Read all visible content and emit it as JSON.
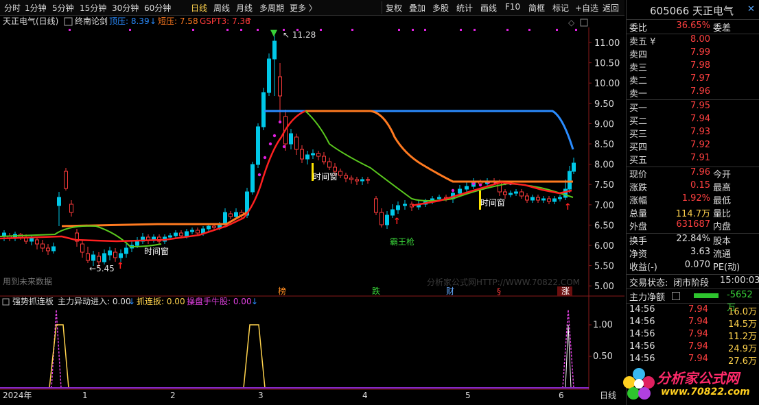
{
  "toolbar": {
    "periods": [
      "分时",
      "1分钟",
      "5分钟",
      "15分钟",
      "30分钟",
      "60分钟",
      "日线",
      "周线",
      "月线",
      "多周期",
      "更多 〉"
    ],
    "active_period": "日线",
    "actions": [
      "复权",
      "叠加",
      "多股",
      "统计",
      "画线",
      "F10",
      "简框",
      "标记",
      "+自选",
      "返回"
    ]
  },
  "main": {
    "stock_name": "天正电气(日线)",
    "indicator_name": "终南论剑",
    "top_pressure": "顶压: 8.39",
    "short_pressure": "短压: 7.58",
    "gspt": "GSPT3: 7.36",
    "high_label": "11.28",
    "low_label": "5.45",
    "watermark_left": "用到未来数据",
    "watermark_right": "分析家公式网HTTP://WWW.70822.COM",
    "annotations": [
      "时间窗",
      "时间窗",
      "时间窗",
      "霸王枪"
    ],
    "event_marks": [
      "榜",
      "跌",
      "财",
      "§",
      "涨"
    ],
    "y_ticks": [
      "11.00",
      "10.50",
      "10.00",
      "9.50",
      "9.00",
      "8.50",
      "8.00",
      "7.50",
      "7.00",
      "6.50",
      "6.00",
      "5.50",
      "5.00"
    ],
    "colors": {
      "up": "#ff3b3b",
      "down": "#00c8e8",
      "red_line": "#ff2020",
      "orange": "#ff7a20",
      "green": "#5ac81e",
      "blue": "#2a8cff",
      "magenta": "#e020e0"
    }
  },
  "sub": {
    "indicator_name": "强势抓连板",
    "field1": "主力异动进入: 0.00",
    "field2": "抓连扳: 0.00",
    "field3": "操盘手牛股: 0.00",
    "y_ticks": [
      "1.00",
      "0.50"
    ]
  },
  "x_axis": {
    "labels": [
      "2024年",
      "1",
      "2",
      "3",
      "4",
      "5",
      "6"
    ],
    "right_label": "日线"
  },
  "panel": {
    "code": "605066",
    "name": "天正电气",
    "weibi": {
      "label": "委比",
      "value": "36.65%",
      "right": "委差"
    },
    "sells": [
      {
        "label": "卖五 ¥",
        "price": "8.00"
      },
      {
        "label": "卖四",
        "price": "7.99"
      },
      {
        "label": "卖三",
        "price": "7.98"
      },
      {
        "label": "卖二",
        "price": "7.97"
      },
      {
        "label": "卖一",
        "price": "7.96"
      }
    ],
    "buys": [
      {
        "label": "买一",
        "price": "7.95"
      },
      {
        "label": "买二",
        "price": "7.94"
      },
      {
        "label": "买三",
        "price": "7.93"
      },
      {
        "label": "买四",
        "price": "7.92"
      },
      {
        "label": "买五",
        "price": "7.91"
      }
    ],
    "stats": [
      {
        "label": "现价",
        "value": "7.96",
        "right": "今开",
        "color": "red"
      },
      {
        "label": "涨跌",
        "value": "0.15",
        "right": "最高",
        "color": "red"
      },
      {
        "label": "涨幅",
        "value": "1.92%",
        "right": "最低",
        "color": "red"
      },
      {
        "label": "总量",
        "value": "114.7万",
        "right": "量比",
        "color": "yel"
      },
      {
        "label": "外盘",
        "value": "631687",
        "right": "内盘",
        "color": "red"
      }
    ],
    "stats2": [
      {
        "label": "换手",
        "value": "22.84%",
        "right": "股本"
      },
      {
        "label": "净资",
        "value": "3.63",
        "right": "流通"
      },
      {
        "label": "收益(-)",
        "value": "0.070",
        "right": "PE(动)"
      }
    ],
    "trade_status": {
      "label": "交易状态:",
      "value": "闭市阶段",
      "time": "15:00:03"
    },
    "main_flow": {
      "label": "主力净额",
      "value": "-5652万"
    },
    "ticks": [
      {
        "time": "14:56",
        "price": "7.94",
        "vol": "16.0万"
      },
      {
        "time": "14:56",
        "price": "7.94",
        "vol": "14.5万"
      },
      {
        "time": "14:56",
        "price": "7.94",
        "vol": "11.2万"
      },
      {
        "time": "14:56",
        "price": "7.94",
        "vol": "24.9万"
      },
      {
        "time": "14:56",
        "price": "7.94",
        "vol": "27.6万"
      }
    ],
    "logo_text": "分析家公式网",
    "logo_url": "www.70822.com"
  }
}
